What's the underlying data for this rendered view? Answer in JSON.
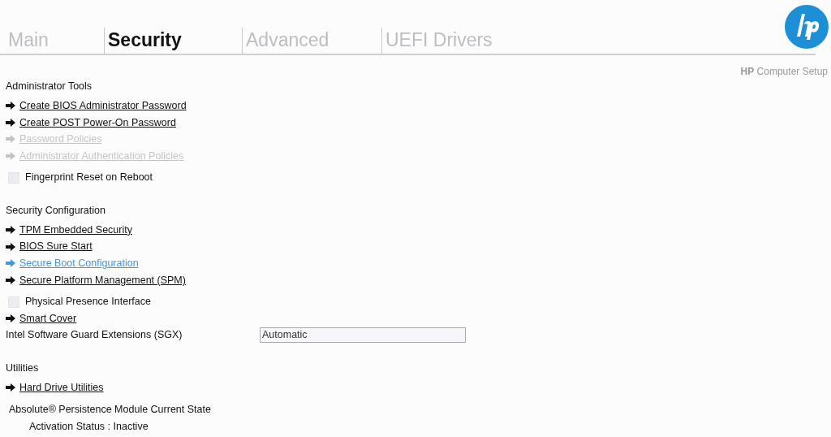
{
  "tabs": [
    {
      "label": "Main",
      "selected": false
    },
    {
      "label": "Security",
      "selected": true
    },
    {
      "label": "Advanced",
      "selected": false
    },
    {
      "label": "UEFI Drivers",
      "selected": false
    }
  ],
  "app_title_brand": "HP",
  "app_title": "Computer Setup",
  "sections": [
    {
      "heading": "Administrator Tools",
      "items": [
        {
          "kind": "link",
          "label": "Create BIOS Administrator Password",
          "disabled": false,
          "selected": false
        },
        {
          "kind": "link",
          "label": "Create POST Power-On Password",
          "disabled": false,
          "selected": false
        },
        {
          "kind": "link",
          "label": "Password Policies",
          "disabled": true,
          "selected": false
        },
        {
          "kind": "link",
          "label": "Administrator Authentication Policies",
          "disabled": true,
          "selected": false
        },
        {
          "kind": "checkbox",
          "label": "Fingerprint Reset on Reboot",
          "checked": false
        }
      ]
    },
    {
      "heading": "Security Configuration",
      "items": [
        {
          "kind": "link",
          "label": "TPM Embedded Security",
          "disabled": false,
          "selected": false
        },
        {
          "kind": "link",
          "label": "BIOS Sure Start",
          "disabled": false,
          "selected": false
        },
        {
          "kind": "link",
          "label": "Secure Boot Configuration",
          "disabled": false,
          "selected": true
        },
        {
          "kind": "link",
          "label": "Secure Platform Management (SPM)",
          "disabled": false,
          "selected": false
        },
        {
          "kind": "checkbox",
          "label": "Physical Presence Interface",
          "checked": false
        },
        {
          "kind": "link",
          "label": "Smart Cover",
          "disabled": false,
          "selected": false
        },
        {
          "kind": "select",
          "label": "Intel Software Guard Extensions (SGX)",
          "value": "Automatic"
        }
      ]
    },
    {
      "heading": "Utilities",
      "items": [
        {
          "kind": "link",
          "label": "Hard Drive Utilities",
          "disabled": false,
          "selected": false
        }
      ]
    }
  ],
  "absolute": {
    "title": "Absolute® Persistence Module Current State",
    "status": "Activation Status : Inactive"
  }
}
